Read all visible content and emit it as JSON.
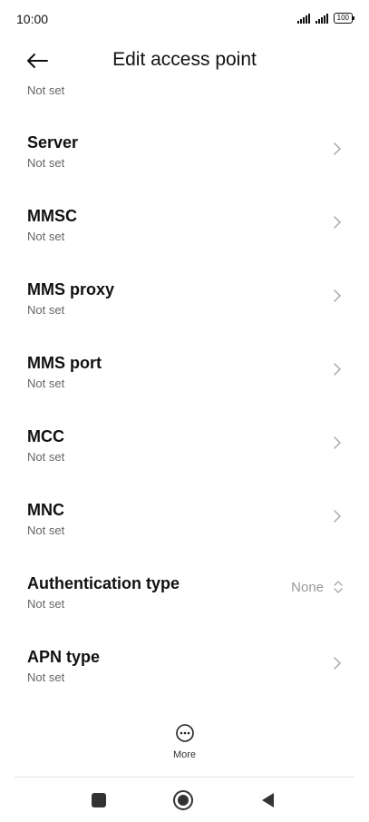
{
  "status": {
    "time": "10:00",
    "battery": "100"
  },
  "header": {
    "title": "Edit access point"
  },
  "clipped_subtitle": "Not set",
  "items": [
    {
      "title": "Server",
      "subtitle": "Not set"
    },
    {
      "title": "MMSC",
      "subtitle": "Not set"
    },
    {
      "title": "MMS proxy",
      "subtitle": "Not set"
    },
    {
      "title": "MMS port",
      "subtitle": "Not set"
    },
    {
      "title": "MCC",
      "subtitle": "Not set"
    },
    {
      "title": "MNC",
      "subtitle": "Not set"
    },
    {
      "title": "Authentication type",
      "subtitle": "Not set",
      "value": "None"
    },
    {
      "title": "APN type",
      "subtitle": "Not set"
    }
  ],
  "more": {
    "label": "More"
  },
  "icons": {
    "back": "back-arrow-icon",
    "chevron": "chevron-right-icon",
    "updown": "updown-icon",
    "more": "more-icon",
    "home": "home-icon",
    "recents": "recents-icon",
    "nav_back": "back-icon"
  }
}
